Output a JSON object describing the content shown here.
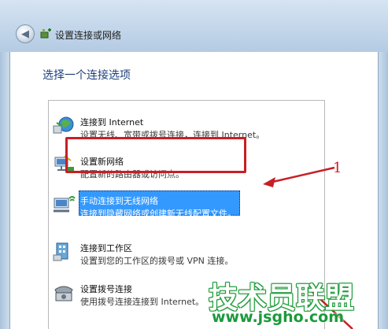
{
  "window": {
    "title": "设置连接或网络"
  },
  "page": {
    "heading": "选择一个连接选项"
  },
  "options": [
    {
      "title": "连接到 Internet",
      "description": "设置无线、宽带或拨号连接，连接到 Internet。",
      "icon": "globe-connect-icon",
      "selected": false
    },
    {
      "title": "设置新网络",
      "description": "配置新的路由器或访问点。",
      "icon": "new-network-icon",
      "selected": false
    },
    {
      "title": "手动连接到无线网络",
      "description": "连接到隐藏网络或创建新无线配置文件。",
      "icon": "wireless-network-icon",
      "selected": true
    },
    {
      "title": "连接到工作区",
      "description": "设置到您的工作区的拨号或 VPN 连接。",
      "icon": "workplace-icon",
      "selected": false
    },
    {
      "title": "设置拨号连接",
      "description": "使用拨号连接连接到 Internet。",
      "icon": "dialup-phone-icon",
      "selected": false
    }
  ],
  "annotation": {
    "label": "1",
    "color": "#c71f24"
  },
  "watermark": {
    "text": "技术员联盟",
    "url": "www.jsgho.com",
    "color": "#1a9a3a"
  },
  "colors": {
    "selection": "#3399ff",
    "heading": "#1c3f7a"
  }
}
